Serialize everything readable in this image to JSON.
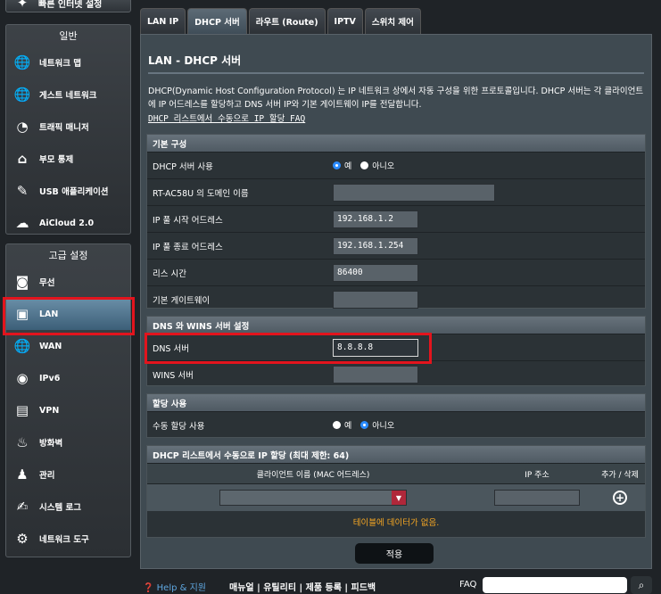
{
  "sidebar": {
    "top_item": "빠른 인터넷 설정",
    "general_header": "일반",
    "general_items": [
      {
        "label": "네트워크 맵",
        "icon": "globe-network-icon"
      },
      {
        "label": "게스트 네트워크",
        "icon": "guest-network-icon"
      },
      {
        "label": "트래픽 매니저",
        "icon": "speedometer-icon"
      },
      {
        "label": "부모 통제",
        "icon": "lock-house-icon"
      },
      {
        "label": "USB 애플리케이션",
        "icon": "puzzle-icon"
      },
      {
        "label": "AiCloud 2.0",
        "icon": "cloud-icon"
      }
    ],
    "advanced_header": "고급 설정",
    "advanced_items": [
      {
        "label": "무선",
        "icon": "wifi-icon"
      },
      {
        "label": "LAN",
        "icon": "monitor-icon"
      },
      {
        "label": "WAN",
        "icon": "globe-icon"
      },
      {
        "label": "IPv6",
        "icon": "ipv6-icon"
      },
      {
        "label": "VPN",
        "icon": "vpn-icon"
      },
      {
        "label": "방화벽",
        "icon": "firewall-icon"
      },
      {
        "label": "관리",
        "icon": "admin-icon"
      },
      {
        "label": "시스템 로그",
        "icon": "log-icon"
      },
      {
        "label": "네트워크 도구",
        "icon": "tools-icon"
      }
    ]
  },
  "tabs": [
    "LAN IP",
    "DHCP 서버",
    "라우트 (Route)",
    "IPTV",
    "스위치 제어"
  ],
  "active_tab": 1,
  "page": {
    "title": "LAN - DHCP 서버",
    "description": "DHCP(Dynamic Host Configuration Protocol) 는 IP 네트워크 상에서 자동 구성을 위한 프로토콜입니다. DHCP 서버는 각 클라이언트에 IP 어드레스를 할당하고 DNS 서버 IP와 기본 게이트웨이 IP를 전달합니다.",
    "faq_link": "DHCP 리스트에서 수동으로 IP 할당 FAQ"
  },
  "basic": {
    "header": "기본 구성",
    "dhcp_enable_label": "DHCP 서버 사용",
    "yes": "예",
    "no": "아니오",
    "domain_label": "RT-AC58U 의 도메인 이름",
    "domain_value": "",
    "pool_start_label": "IP 풀 시작 어드레스",
    "pool_start_value": "192.168.1.2",
    "pool_end_label": "IP 풀 종료 어드레스",
    "pool_end_value": "192.168.1.254",
    "lease_label": "리스 시간",
    "lease_value": "86400",
    "gateway_label": "기본 게이트웨이",
    "gateway_value": ""
  },
  "dns": {
    "header": "DNS 와 WINS 서버 설정",
    "dns_label": "DNS 서버",
    "dns_value": "8.8.8.8",
    "wins_label": "WINS 서버",
    "wins_value": ""
  },
  "manual": {
    "header": "할당 사용",
    "label": "수동 할당 사용",
    "yes": "예",
    "no": "아니오"
  },
  "table": {
    "header": "DHCP 리스트에서 수동으로 IP 할당 (최대 제한: 64)",
    "col_client": "클라이언트 이름 (MAC 어드레스)",
    "col_ip": "IP 주소",
    "col_action": "추가 / 삭제",
    "empty": "테이블에 데이터가 없음."
  },
  "apply_label": "적용",
  "footer": {
    "help": "Help & 지원",
    "links": "매뉴얼 | 유틸리티 | 제품 등록 | 피드백",
    "faq": "FAQ"
  },
  "colors": {
    "highlight_red": "#e3141d",
    "radio_blue": "#2a8bff",
    "empty_text": "#f5a623"
  }
}
